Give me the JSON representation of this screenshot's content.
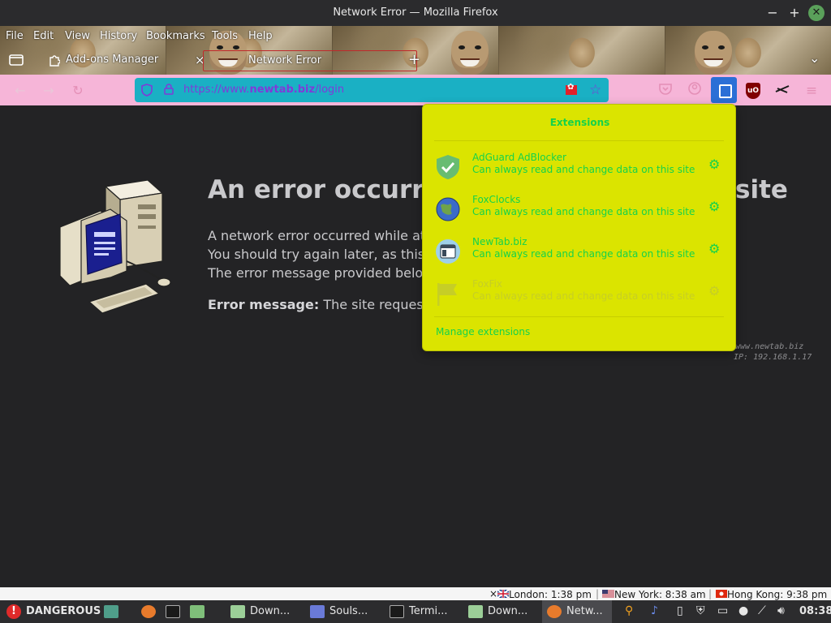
{
  "window": {
    "title": "Network Error — Mozilla Firefox",
    "minimize": "−",
    "maximize": "+",
    "close": "✕"
  },
  "menubar": {
    "file": "File",
    "edit": "Edit",
    "view": "View",
    "history": "History",
    "bookmarks": "Bookmarks",
    "tools": "Tools",
    "help": "Help"
  },
  "tabs": [
    {
      "label": "Add-ons Manager",
      "active": false
    },
    {
      "label": "Network Error",
      "active": true
    }
  ],
  "tab_strip": {
    "close_tab": "×",
    "new_tab": "+",
    "list_all": "⌄"
  },
  "url": {
    "prefix": "https://www.",
    "domain": "newtab.biz",
    "suffix": "/login"
  },
  "error": {
    "title_visible": "An error occurre",
    "title_tail": "site",
    "line1": "A network error occurred while atte",
    "line2": "You should try again later, as this m",
    "line3": "The error message provided below",
    "message_label": "Error message:",
    "message_text": "The site requested",
    "side_url": "/www.newtab.biz",
    "side_ip": "IP: 192.168.1.17"
  },
  "extensions_panel": {
    "title": "Extensions",
    "items": [
      {
        "name": "AdGuard AdBlocker",
        "desc": "Can always read and change data on this site",
        "icon": "adguard-shield-icon",
        "enabled": true
      },
      {
        "name": "FoxClocks",
        "desc": "Can always read and change data on this site",
        "icon": "globe-icon",
        "enabled": true
      },
      {
        "name": "NewTab.biz",
        "desc": "Can always read and change data on this site",
        "icon": "newtab-window-icon",
        "enabled": true
      },
      {
        "name": "FoxFix",
        "desc": "Can always read and change data on this site",
        "icon": "flag-icon",
        "enabled": false
      }
    ],
    "manage": "Manage extensions"
  },
  "clocks": [
    {
      "label": "London: 1:38 pm"
    },
    {
      "label": "New York: 8:38 am"
    },
    {
      "label": "Hong Kong: 9:38 pm"
    }
  ],
  "clock_close": "×",
  "taskbar": {
    "warning_label": "DANGEROUS",
    "items": [
      {
        "label": "Down..."
      },
      {
        "label": "Souls..."
      },
      {
        "label": "Termi..."
      },
      {
        "label": "Down..."
      },
      {
        "label": "Netw..."
      }
    ],
    "time": "08:38"
  },
  "colors": {
    "navbar": "#f6b5d8",
    "urlbar": "#1ab0c4",
    "url_text": "#7f3bd8",
    "panel_bg": "#dbe400",
    "panel_text": "#15d24a",
    "page_bg": "#232325"
  }
}
